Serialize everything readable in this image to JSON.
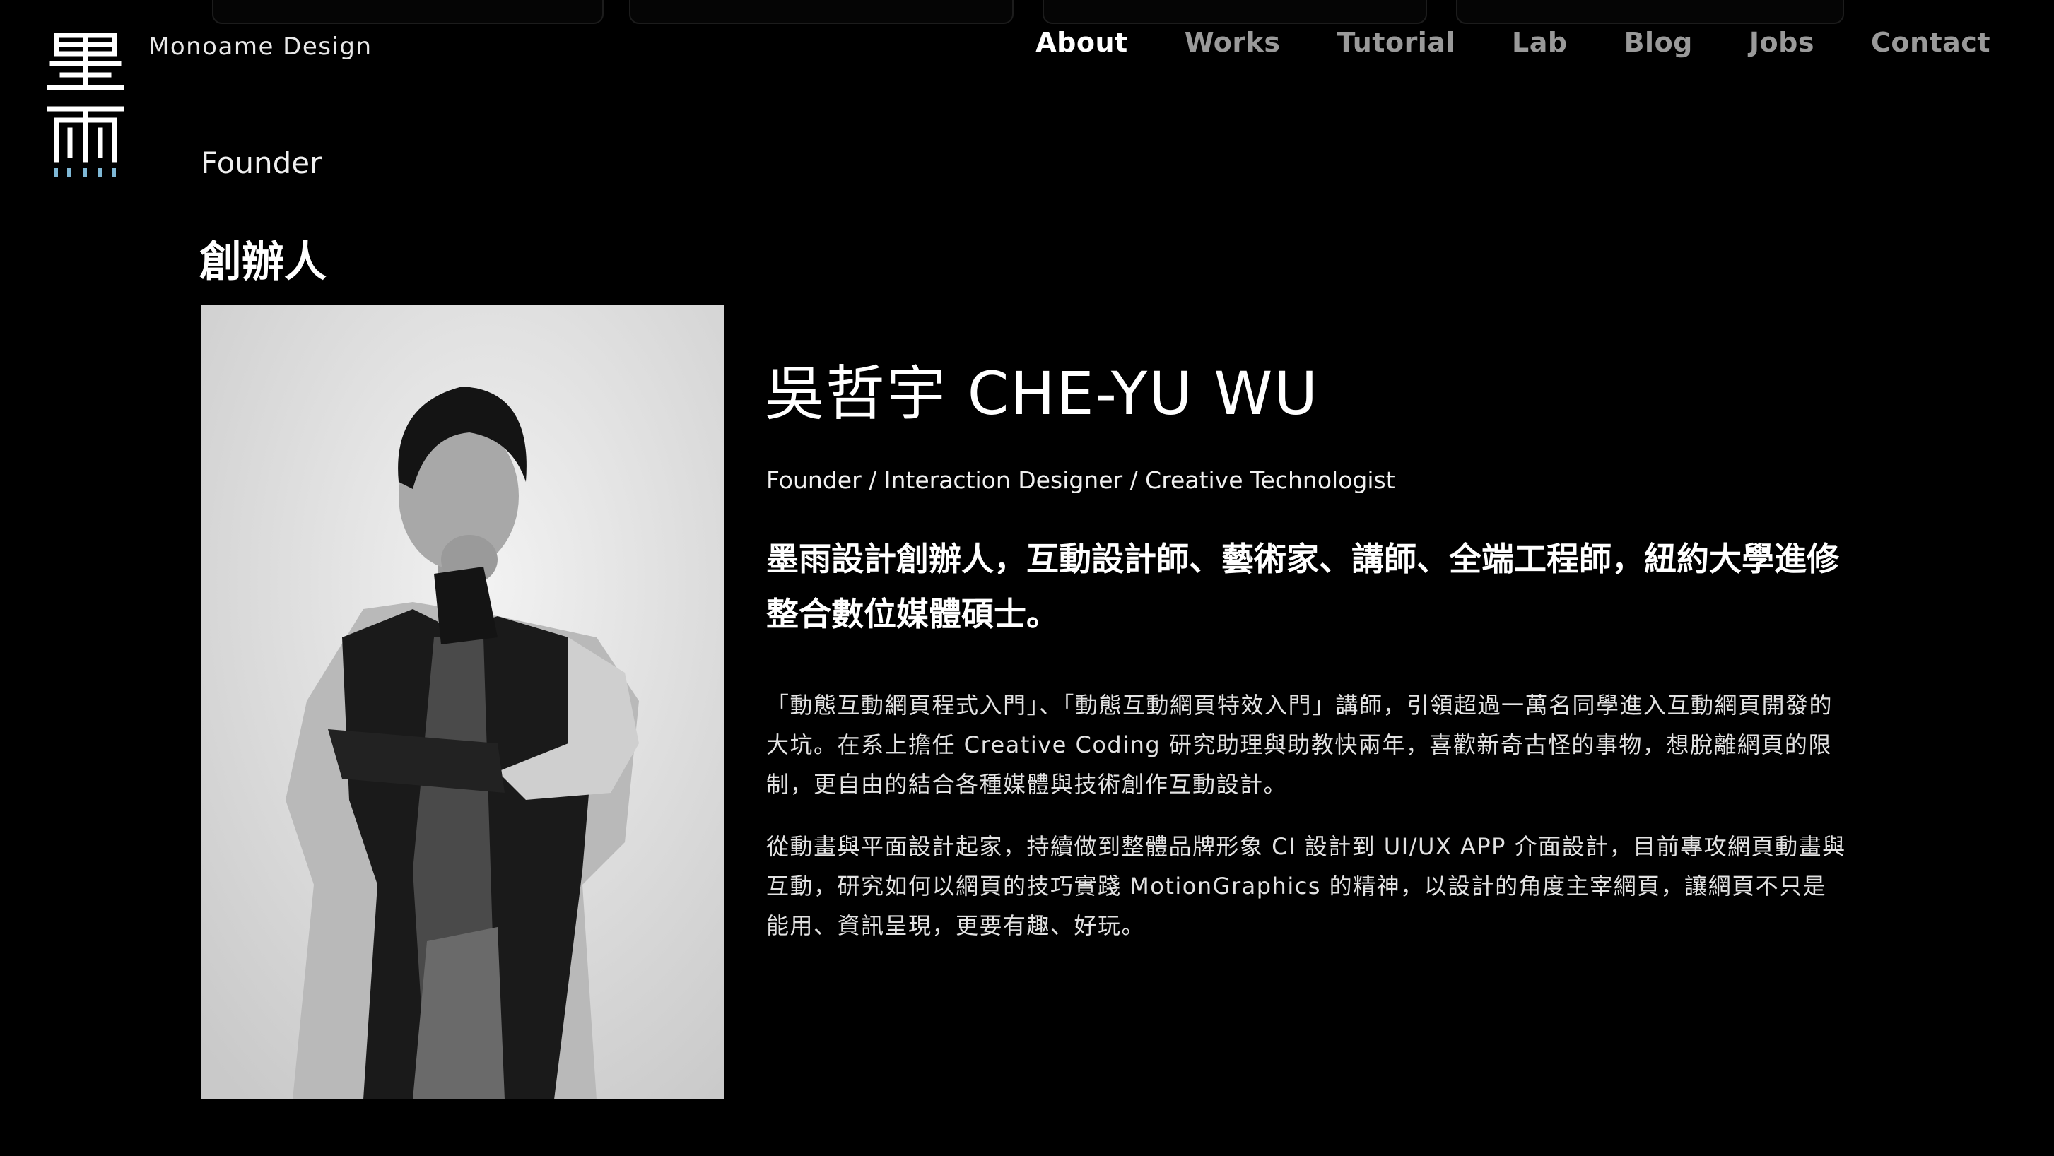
{
  "header": {
    "brand_name": "Monoame Design",
    "logo_glyph": "墨雨"
  },
  "nav": {
    "items": [
      {
        "label": "About",
        "active": true
      },
      {
        "label": "Works",
        "active": false
      },
      {
        "label": "Tutorial",
        "active": false
      },
      {
        "label": "Lab",
        "active": false
      },
      {
        "label": "Blog",
        "active": false
      },
      {
        "label": "Jobs",
        "active": false
      },
      {
        "label": "Contact",
        "active": false
      }
    ]
  },
  "section": {
    "label": "Founder",
    "title": "創辦人"
  },
  "profile": {
    "name": "吳哲宇 CHE-YU WU",
    "roles": "Founder / Interaction Designer / Creative Technologist",
    "lead": "墨雨設計創辦人，互動設計師、藝術家、講師、全端工程師，紐約大學進修整合數位媒體碩士。",
    "paragraphs": [
      "「動態互動網頁程式入門」、「動態互動網頁特效入門」講師，引領超過一萬名同學進入互動網頁開發的大坑。在系上擔任 Creative Coding 研究助理與助教快兩年，喜歡新奇古怪的事物，想脫離網頁的限制，更自由的結合各種媒體與技術創作互動設計。",
      "從動畫與平面設計起家，持續做到整體品牌形象 CI 設計到 UI/UX APP 介面設計，目前專攻網頁動畫與互動，研究如何以網頁的技巧實踐 MotionGraphics 的精神，以設計的角度主宰網頁，讓網頁不只是能用、資訊呈現，更要有趣、好玩。"
    ]
  },
  "colors": {
    "background": "#000000",
    "nav_active": "#ffffff",
    "nav_inactive": "#9a9a9a",
    "logo_accent": "#7fb8d6"
  }
}
